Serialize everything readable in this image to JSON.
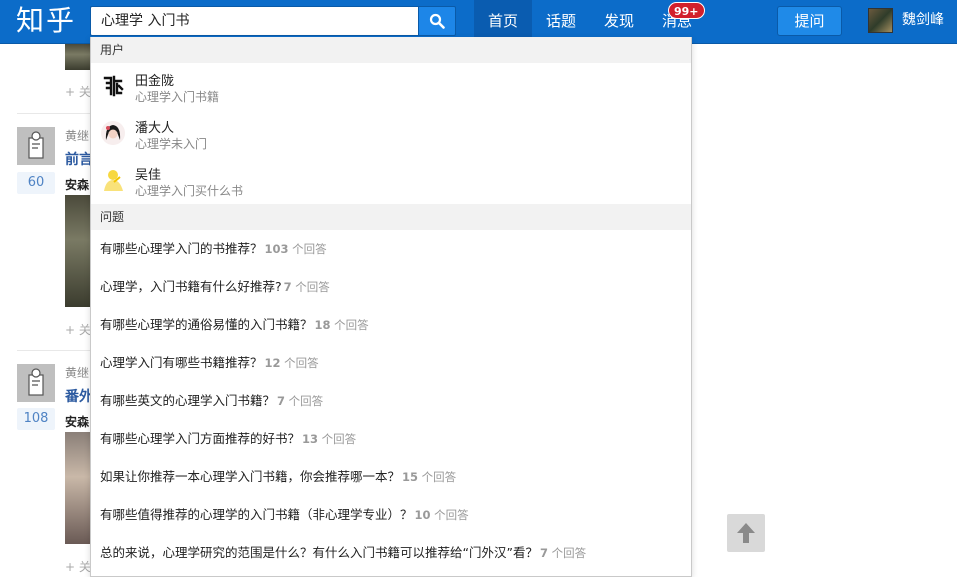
{
  "header": {
    "logo": "知乎",
    "search_value": "心理学 入门书",
    "nav": [
      "首页",
      "话题",
      "发现",
      "消息"
    ],
    "badge": "99+",
    "ask_label": "提问",
    "user_name": "魏剑峰"
  },
  "feed": {
    "items": [
      {
        "author": "黄继",
        "title": "前言",
        "answerer": "安森",
        "votes": "60",
        "follow": "+ 关"
      },
      {
        "author": "黄继",
        "title": "番外",
        "answerer": "安森",
        "votes": "108",
        "follow": "+ 关"
      }
    ],
    "top_follow": "+ 关",
    "bottom_follow": "+ 关"
  },
  "dropdown": {
    "users_header": "用户",
    "users": [
      {
        "name": "田金陇",
        "bio": "心理学入门书籍"
      },
      {
        "name": "潘大人",
        "bio": "心理学未入门"
      },
      {
        "name": "吴佳",
        "bio": "心理学入门买什么书"
      }
    ],
    "questions_header": "问题",
    "questions": [
      {
        "text": "有哪些心理学入门的书推荐？",
        "num": "103",
        "suffix": " 个回答"
      },
      {
        "text": "心理学，入门书籍有什么好推荐?",
        "num": "7",
        "suffix": " 个回答"
      },
      {
        "text": "有哪些心理学的通俗易懂的入门书籍？",
        "num": "18",
        "suffix": " 个回答"
      },
      {
        "text": "心理学入门有哪些书籍推荐？",
        "num": "12",
        "suffix": " 个回答"
      },
      {
        "text": "有哪些英文的心理学入门书籍？",
        "num": "7",
        "suffix": " 个回答"
      },
      {
        "text": "有哪些心理学入门方面推荐的好书？",
        "num": "13",
        "suffix": " 个回答"
      },
      {
        "text": "如果让你推荐一本心理学入门书籍，你会推荐哪一本？",
        "num": "15",
        "suffix": " 个回答"
      },
      {
        "text": "有哪些值得推荐的心理学的入门书籍（非心理学专业）？",
        "num": "10",
        "suffix": " 个回答"
      },
      {
        "text": "总的来说，心理学研究的范围是什么？有什么入门书籍可以推荐给“门外汉”看？",
        "num": "7",
        "suffix": " 个回答"
      }
    ]
  }
}
